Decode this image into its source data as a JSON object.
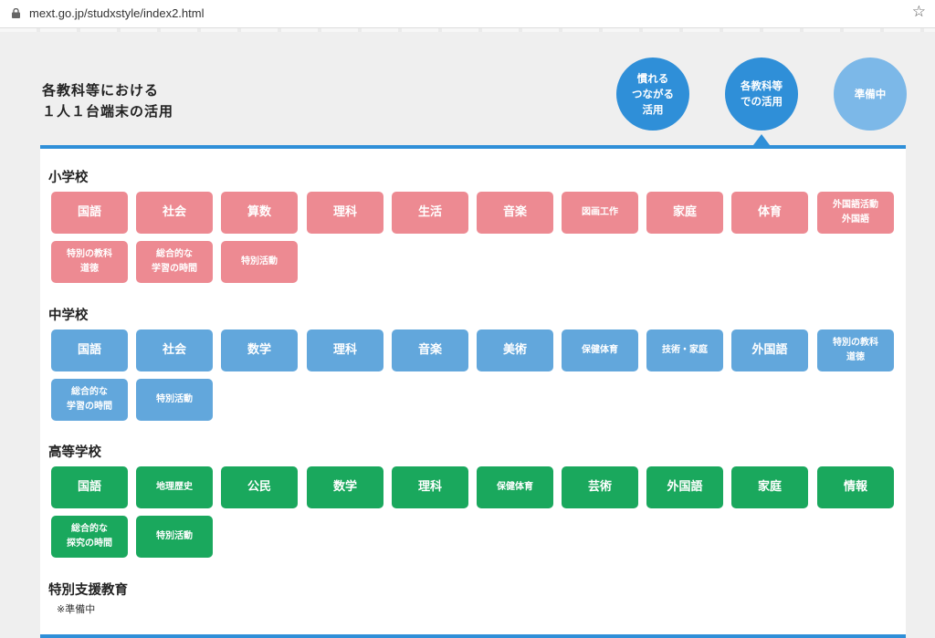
{
  "browser": {
    "url": "mext.go.jp/studxstyle/index2.html"
  },
  "header": {
    "title": "各教科等における\n１人１台端末の活用",
    "circles": [
      "慣れる\nつながる\n活用",
      "各教科等\nでの活用",
      "準備中"
    ]
  },
  "sections": {
    "elementary": {
      "title": "小学校",
      "buttons": [
        "国語",
        "社会",
        "算数",
        "理科",
        "生活",
        "音楽",
        "図画工作",
        "家庭",
        "体育",
        "外国語活動\n外国語",
        "特別の教科\n道徳",
        "総合的な\n学習の時間",
        "特別活動"
      ]
    },
    "junior": {
      "title": "中学校",
      "buttons": [
        "国語",
        "社会",
        "数学",
        "理科",
        "音楽",
        "美術",
        "保健体育",
        "技術・家庭",
        "外国語",
        "特別の教科\n道徳",
        "総合的な\n学習の時間",
        "特別活動"
      ]
    },
    "high": {
      "title": "高等学校",
      "buttons": [
        "国語",
        "地理歴史",
        "公民",
        "数学",
        "理科",
        "保健体育",
        "芸術",
        "外国語",
        "家庭",
        "情報",
        "総合的な\n探究の時間",
        "特別活動"
      ]
    },
    "special": {
      "title": "特別支援教育",
      "note": "※準備中"
    }
  },
  "colors": {
    "elementary": "#ed8a92",
    "junior": "#62a7dc",
    "high": "#1aa85d",
    "accent": "#2f8fd8"
  }
}
